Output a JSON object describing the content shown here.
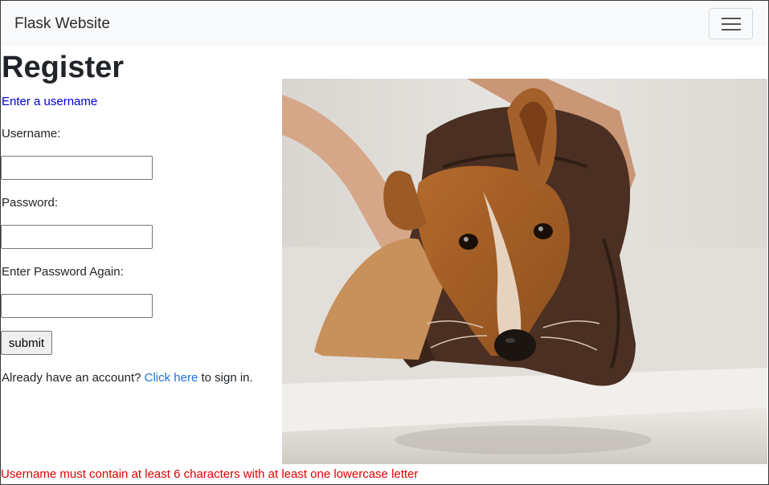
{
  "navbar": {
    "brand": "Flask Website",
    "toggle_icon": "hamburger-menu-icon"
  },
  "page": {
    "title": "Register",
    "prompt": "Enter a username"
  },
  "form": {
    "username_label": "Username:",
    "username_value": "",
    "password_label": "Password:",
    "password_value": "",
    "password_again_label": "Enter Password Again:",
    "password_again_value": "",
    "submit_label": "submit"
  },
  "signin": {
    "prefix": "Already have an account? ",
    "link_text": "Click here",
    "suffix": " to sign in."
  },
  "error": "Username must contain at least 6 characters with at least one lowercase letter",
  "colors": {
    "navbar_bg": "#f8f9fa",
    "prompt_text": "#0000cc",
    "link": "#1a73d9",
    "error_text": "#e00000"
  },
  "image": {
    "subject": "dog-being-dried-with-towel-in-bathtub"
  }
}
